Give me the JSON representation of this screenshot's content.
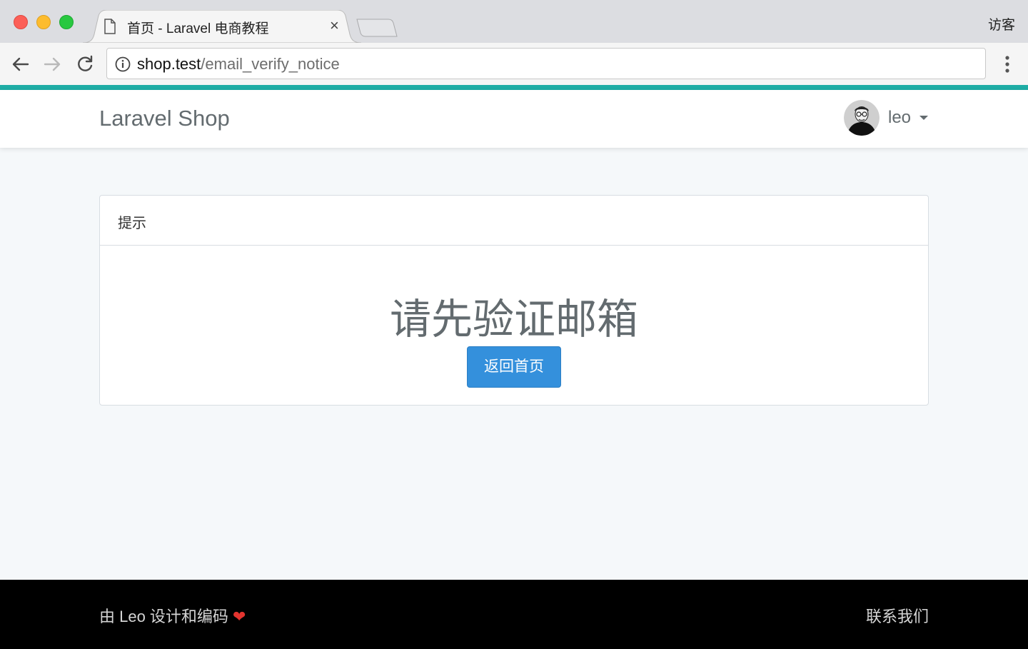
{
  "browser": {
    "tab": {
      "title": "首页 - Laravel 电商教程",
      "close_symbol": "×",
      "icon": "document-icon"
    },
    "profile_label": "访客",
    "address": {
      "host": "shop.test",
      "path": "/email_verify_notice"
    },
    "icons": {
      "back": "back-arrow-icon",
      "forward": "forward-arrow-icon",
      "reload": "reload-icon",
      "info": "info-icon",
      "menu": "menu-dots-icon"
    }
  },
  "colors": {
    "accent": "#1fada5",
    "primary_button": "#3490dc",
    "page_background": "#f5f8fa",
    "footer_background": "#000000",
    "heart": "#e3342f"
  },
  "navbar": {
    "brand": "Laravel Shop",
    "user": {
      "name": "leo",
      "avatar_icon": "avatar-icon",
      "caret_icon": "caret-down-icon"
    }
  },
  "card": {
    "header": "提示",
    "message": "请先验证邮箱",
    "button_label": "返回首页"
  },
  "footer": {
    "credit": "由 Leo 设计和编码",
    "heart_symbol": "❤",
    "contact": "联系我们"
  }
}
